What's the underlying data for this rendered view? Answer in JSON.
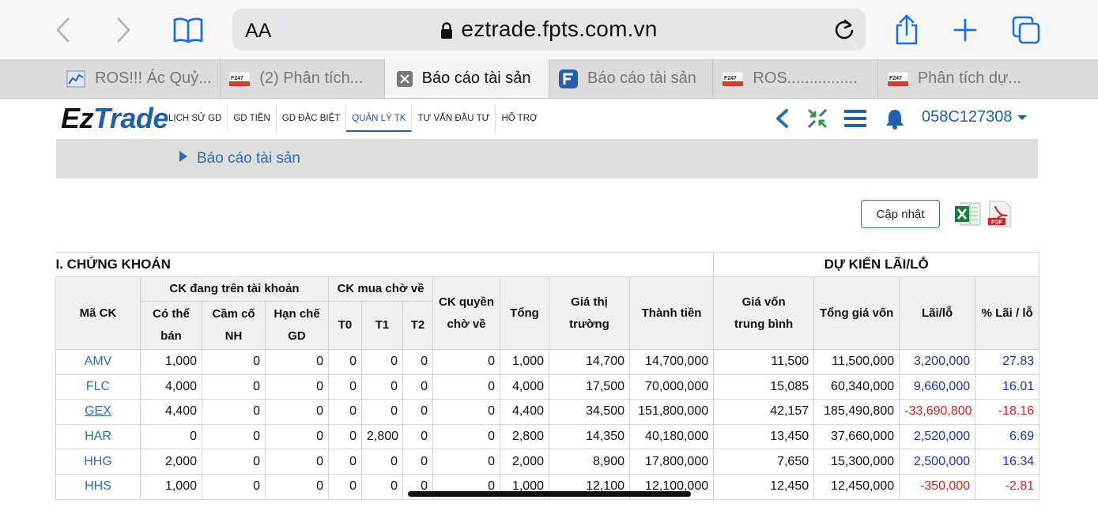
{
  "browser": {
    "url_aa": "AA",
    "url": "eztrade.fpts.com.vn",
    "tabs": [
      {
        "title": "ROS!!! Ác Quỷ...",
        "icon": "chart-icon",
        "active": false
      },
      {
        "title": "(2) Phân tích...",
        "icon": "f247-icon",
        "active": false
      },
      {
        "title": "Báo cáo tài sản",
        "icon": "close-icon",
        "active": true
      },
      {
        "title": "Báo cáo tài sản",
        "icon": "fpts-icon",
        "active": false
      },
      {
        "title": "ROS................",
        "icon": "f247-icon",
        "active": false
      },
      {
        "title": "Phân tích dự...",
        "icon": "f247-icon",
        "active": false
      }
    ]
  },
  "app": {
    "logo_ez": "Ez",
    "logo_trade": "Trade",
    "menu": [
      "LỊCH SỬ GD",
      "GD TIỀN",
      "GD ĐẶC BIỆT",
      "QUẢN LÝ TK",
      "TƯ VẤN ĐẦU TƯ",
      "HỖ TRỢ"
    ],
    "active_menu": "QUẢN LÝ TK",
    "account": "058C127308",
    "breadcrumb": "Báo cáo tài sản",
    "update_button": "Cập nhật",
    "pdf_label": "PDF",
    "colors": {
      "brand": "#1f5fae",
      "positive": "#1d32c8",
      "negative": "#d61f1f"
    }
  },
  "table": {
    "section_left": "I. CHỨNG KHOÁN",
    "section_right": "DỰ KIẾN LÃI/LỖ",
    "headers": {
      "ma_ck": "Mã CK",
      "ck_dang": "CK đang trên tài khoản",
      "co_the_ban": "Có thể bán",
      "cam_co": "Cầm cố NH",
      "han_che": "Hạn chế GD",
      "ck_mua": "CK mua chờ về",
      "t0": "T0",
      "t1": "T1",
      "t2": "T2",
      "ck_quyen": "CK quyền chờ về",
      "tong": "Tổng",
      "gia_tt": "Giá thị trường",
      "thanh_tien": "Thành tiền",
      "gia_von_tb": "Giá vốn trung bình",
      "tong_gia_von": "Tổng giá vốn",
      "lai_lo": "Lãi/lỗ",
      "pct_lai_lo": "% Lãi / lỗ"
    },
    "rows": [
      {
        "code": "AMV",
        "co_the_ban": "1,000",
        "cam_co": "0",
        "han_che": "0",
        "t0": "0",
        "t1": "0",
        "t2": "0",
        "quyen": "0",
        "tong": "1,000",
        "gia_tt": "14,700",
        "thanh_tien": "14,700,000",
        "gia_von": "11,500",
        "tong_gia_von": "11,500,000",
        "lai_lo": "3,200,000",
        "pct": "27.83",
        "sign": "pos"
      },
      {
        "code": "FLC",
        "co_the_ban": "4,000",
        "cam_co": "0",
        "han_che": "0",
        "t0": "0",
        "t1": "0",
        "t2": "0",
        "quyen": "0",
        "tong": "4,000",
        "gia_tt": "17,500",
        "thanh_tien": "70,000,000",
        "gia_von": "15,085",
        "tong_gia_von": "60,340,000",
        "lai_lo": "9,660,000",
        "pct": "16.01",
        "sign": "pos"
      },
      {
        "code": "GEX",
        "co_the_ban": "4,400",
        "cam_co": "0",
        "han_che": "0",
        "t0": "0",
        "t1": "0",
        "t2": "0",
        "quyen": "0",
        "tong": "4,400",
        "gia_tt": "34,500",
        "thanh_tien": "151,800,000",
        "gia_von": "42,157",
        "tong_gia_von": "185,490,800",
        "lai_lo": "-33,690,800",
        "pct": "-18.16",
        "sign": "neg"
      },
      {
        "code": "HAR",
        "co_the_ban": "0",
        "cam_co": "0",
        "han_che": "0",
        "t0": "0",
        "t1": "2,800",
        "t2": "0",
        "quyen": "0",
        "tong": "2,800",
        "gia_tt": "14,350",
        "thanh_tien": "40,180,000",
        "gia_von": "13,450",
        "tong_gia_von": "37,660,000",
        "lai_lo": "2,520,000",
        "pct": "6.69",
        "sign": "pos"
      },
      {
        "code": "HHG",
        "co_the_ban": "2,000",
        "cam_co": "0",
        "han_che": "0",
        "t0": "0",
        "t1": "0",
        "t2": "0",
        "quyen": "0",
        "tong": "2,000",
        "gia_tt": "8,900",
        "thanh_tien": "17,800,000",
        "gia_von": "7,650",
        "tong_gia_von": "15,300,000",
        "lai_lo": "2,500,000",
        "pct": "16.34",
        "sign": "pos"
      },
      {
        "code": "HHS",
        "co_the_ban": "1,000",
        "cam_co": "0",
        "han_che": "0",
        "t0": "0",
        "t1": "0",
        "t2": "0",
        "quyen": "0",
        "tong": "1,000",
        "gia_tt": "12,100",
        "thanh_tien": "12,100,000",
        "gia_von": "12,450",
        "tong_gia_von": "12,450,000",
        "lai_lo": "-350,000",
        "pct": "-2.81",
        "sign": "neg"
      }
    ]
  }
}
